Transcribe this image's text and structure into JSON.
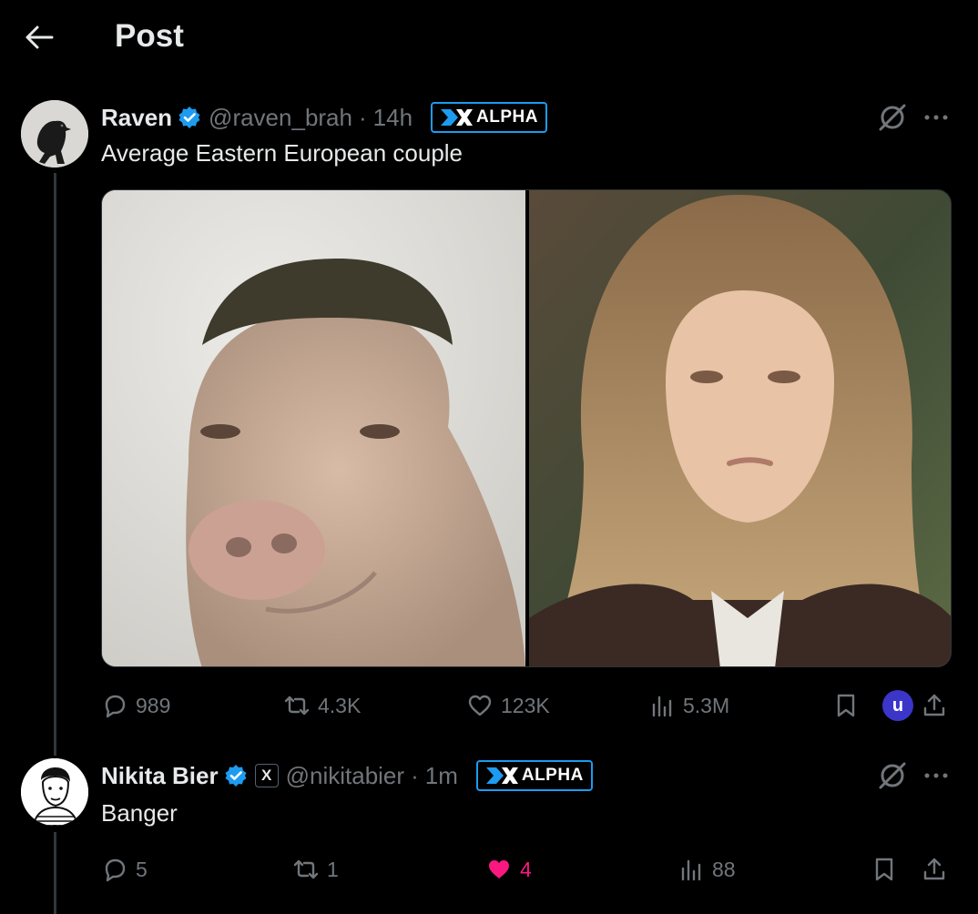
{
  "header": {
    "title": "Post",
    "back_icon": "arrow-left-icon"
  },
  "tweets": [
    {
      "name": "Raven",
      "handle": "@raven_brah",
      "separator": "·",
      "time": "14h",
      "badge": "ALPHA",
      "text": "Average Eastern European couple",
      "media": [
        "pig-with-buzzcut-photo",
        "woman-with-long-blonde-hair-photo"
      ],
      "actions": {
        "replies": "989",
        "reposts": "4.3K",
        "likes": "123K",
        "views": "5.3M"
      },
      "user_badge": "u"
    },
    {
      "name": "Nikita Bier",
      "handle": "@nikitabier",
      "separator": "·",
      "time": "1m",
      "affiliate": "X",
      "badge": "ALPHA",
      "text": "Banger",
      "actions": {
        "replies": "5",
        "reposts": "1",
        "likes": "4",
        "views": "88"
      },
      "liked": true
    }
  ],
  "colors": {
    "accent": "#1d9bf0",
    "like": "#f91880",
    "muted": "#71767b",
    "background": "#000000"
  }
}
